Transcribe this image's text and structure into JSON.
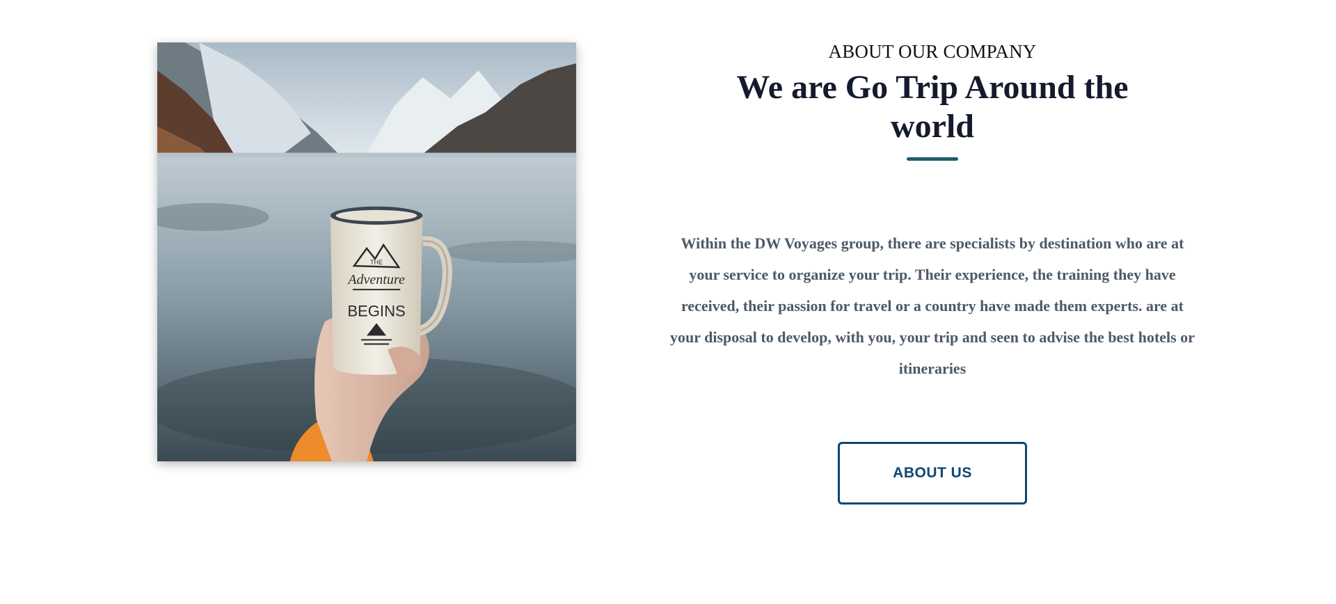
{
  "about": {
    "eyebrow": "ABOUT OUR COMPANY",
    "title": "We are Go Trip Around the world",
    "description": "Within the DW Voyages group, there are specialists by destination who are at your service to organize your trip. Their experience, the training they have received, their passion for travel or a country have made them experts. are at your disposal to develop, with you, your trip and seen to advise the best hotels or itineraries",
    "button_label": "ABOUT US"
  },
  "photo": {
    "mug_text": [
      "THE",
      "Adventure",
      "BEGINS"
    ]
  },
  "colors": {
    "heading": "#161a2d",
    "accent_underline": "#1d5d6e",
    "body_text": "#4d5968",
    "button": "#0f4670"
  }
}
